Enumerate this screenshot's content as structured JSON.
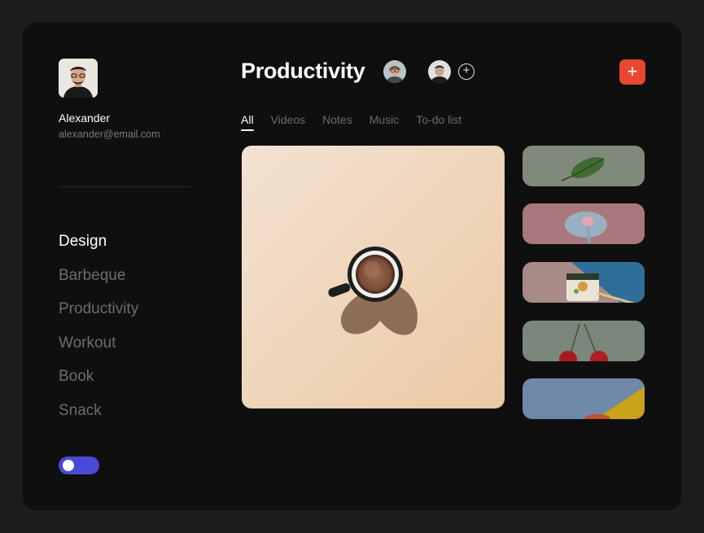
{
  "user": {
    "name": "Alexander",
    "email": "alexander@email.com"
  },
  "sidebar": {
    "items": [
      {
        "label": "Design",
        "active": true
      },
      {
        "label": "Barbeque",
        "active": false
      },
      {
        "label": "Productivity",
        "active": false
      },
      {
        "label": "Workout",
        "active": false
      },
      {
        "label": "Book",
        "active": false
      },
      {
        "label": "Snack",
        "active": false
      }
    ],
    "theme_toggle_on": true
  },
  "header": {
    "title": "Productivity",
    "add_member_label": "+",
    "add_label": "+"
  },
  "tabs": [
    {
      "label": "All",
      "active": true
    },
    {
      "label": "Videos",
      "active": false
    },
    {
      "label": "Notes",
      "active": false
    },
    {
      "label": "Music",
      "active": false
    },
    {
      "label": "To-do list",
      "active": false
    }
  ],
  "colors": {
    "accent": "#e8482f",
    "toggle": "#4a4ad6",
    "panel": "#0f0f0f",
    "background": "#1c1c1c"
  }
}
